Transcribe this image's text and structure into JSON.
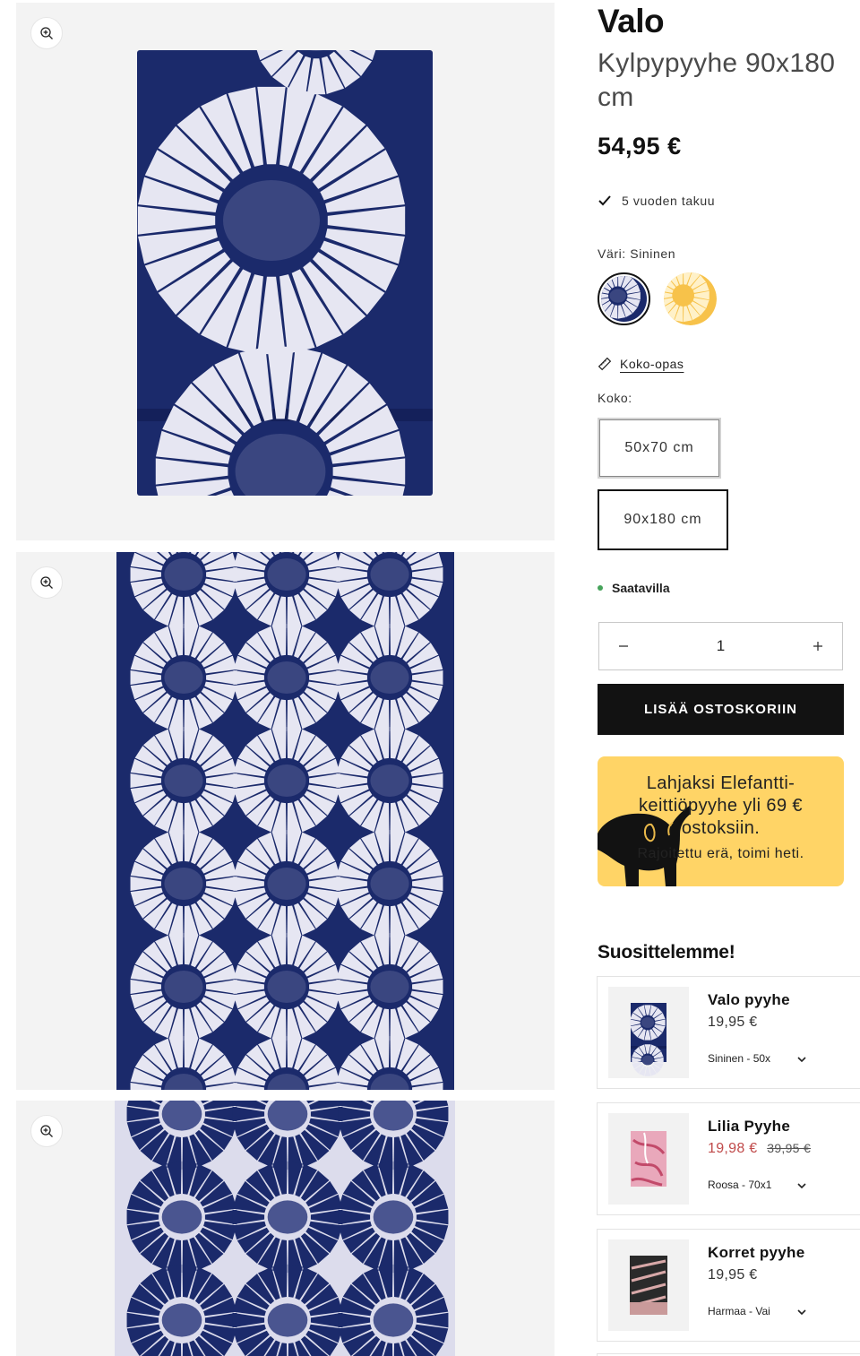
{
  "product": {
    "brand": "Valo",
    "subtitle": "Kylpypyyhe 90x180 cm",
    "price": "54,95 €",
    "warranty": "5 vuoden takuu",
    "color_label": "Väri: Sininen",
    "swatches": [
      {
        "name": "Sininen",
        "color": "#1b2a6b",
        "selected": true
      },
      {
        "name": "Keltainen",
        "color": "#f7c24a",
        "selected": false
      }
    ],
    "size_guide": "Koko-opas",
    "size_label": "Koko:",
    "sizes": [
      {
        "label": "50x70 cm",
        "selected": false
      },
      {
        "label": "90x180 cm",
        "selected": true
      }
    ],
    "stock": "Saatavilla",
    "quantity": "1",
    "add_to_cart": "LISÄÄ OSTOSKORIIN"
  },
  "promo": {
    "title": "Lahjaksi Elefantti-keittiöpyyhe yli 69 € ostoksiin.",
    "subtitle": "Rajoitettu erä, toimi heti.",
    "bg": "#ffd466"
  },
  "recommendations": {
    "heading": "Suosittelemme!",
    "items": [
      {
        "name": "Valo pyyhe",
        "price": "19,95 €",
        "sale_price": "",
        "old_price": "",
        "variant": "Sininen - 50x"
      },
      {
        "name": "Lilia Pyyhe",
        "price": "",
        "sale_price": "19,98 €",
        "old_price": "39,95 €",
        "variant": "Roosa - 70x1"
      },
      {
        "name": "Korret pyyhe",
        "price": "19,95 €",
        "sale_price": "",
        "old_price": "",
        "variant": "Harmaa - Vai"
      }
    ]
  },
  "colors": {
    "navy": "#1b2a6b",
    "accent_dark": "#121212",
    "sale_red": "#c04a4a",
    "stock_green": "#46a35b"
  },
  "icons": [
    "zoom-in-icon",
    "check-icon",
    "ruler-icon",
    "minus-icon",
    "plus-icon",
    "chevron-down-icon",
    "elephant-icon"
  ]
}
